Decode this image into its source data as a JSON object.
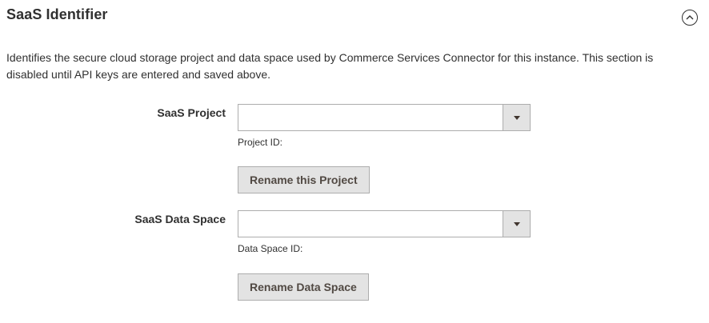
{
  "section": {
    "title": "SaaS Identifier",
    "description": "Identifies the secure cloud storage project and data space used by Commerce Services Connector for this instance. This section is disabled until API keys are entered and saved above."
  },
  "saas_project": {
    "label": "SaaS Project",
    "selected_value": "",
    "note_label": "Project ID:",
    "note_value": "",
    "rename_button": "Rename this Project"
  },
  "saas_data_space": {
    "label": "SaaS Data Space",
    "selected_value": "",
    "note_label": "Data Space ID:",
    "note_value": "",
    "rename_button": "Rename Data Space"
  },
  "icons": {
    "collapse": "chevron-up-circle-icon",
    "dropdown": "triangle-down-icon"
  },
  "colors": {
    "text": "#303030",
    "border": "#adadad",
    "button_bg": "#e3e3e3",
    "button_text": "#514943"
  }
}
